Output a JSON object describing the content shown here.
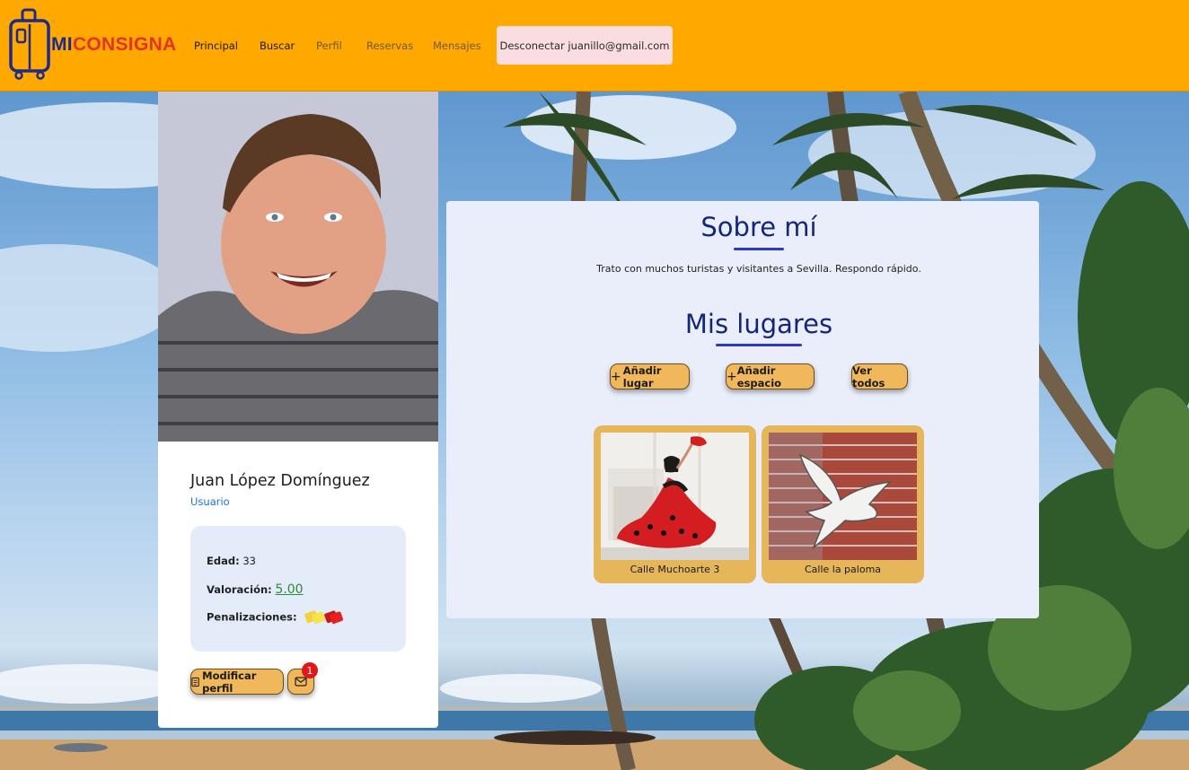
{
  "header": {
    "logo": {
      "part1": "MI",
      "part2": "CONSIGNA"
    },
    "nav": [
      {
        "label": "Principal"
      },
      {
        "label": "Buscar"
      },
      {
        "label": "Perfil"
      },
      {
        "label": "Reservas"
      },
      {
        "label": "Mensajes"
      }
    ],
    "logout_label": "Desconectar juanillo@gmail.com"
  },
  "profile": {
    "name": "Juan López Domínguez",
    "role": "Usuario",
    "age_label": "Edad:",
    "age": "33",
    "rating_label": "Valoración:",
    "rating": "5.00",
    "penalties_label": "Penalizaciones:",
    "penalty_cards": [
      "yellow",
      "red"
    ],
    "edit_button": "Modificar perfil",
    "messages_badge": "1"
  },
  "about": {
    "title": "Sobre mí",
    "text": "Trato con muchos turistas y visitantes a Sevilla. Respondo rápido."
  },
  "places": {
    "title": "Mis lugares",
    "add_place": "Añadir lugar",
    "add_space": "Añadir espacio",
    "view_all": "Ver todos",
    "items": [
      {
        "name": "Calle Muchoarte 3"
      },
      {
        "name": "Calle la paloma"
      }
    ]
  },
  "colors": {
    "header_bg": "#ffa800",
    "accent_button": "#f0b85a",
    "title": "#14267a",
    "logout_bg": "#f9dde0"
  }
}
